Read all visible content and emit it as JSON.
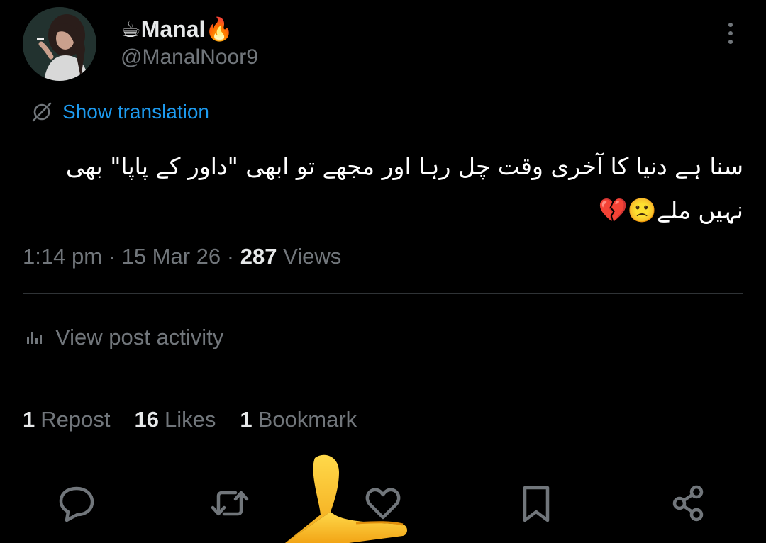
{
  "author": {
    "name": "Manal",
    "name_prefix_emoji": "☕",
    "name_suffix_emoji": "🔥",
    "handle": "@ManalNoor9"
  },
  "translate": {
    "label": "Show translation",
    "icon": "translate-globe-icon"
  },
  "post": {
    "text": "سنا ہے دنیا کا آخری وقت چل رہا اور مجھے تو ابھی \"داور کے پاپا\" بھی نہیں ملے🙁💔"
  },
  "meta": {
    "time": "1:14 pm",
    "separator": " · ",
    "date": "15 Mar 26",
    "views_count": "287",
    "views_label": "Views"
  },
  "activity": {
    "label": "View post activity",
    "icon": "bar-chart-icon"
  },
  "stats": [
    {
      "count": "1",
      "label": "Repost"
    },
    {
      "count": "16",
      "label": "Likes"
    },
    {
      "count": "1",
      "label": "Bookmark"
    }
  ],
  "actions": {
    "reply": "reply-icon",
    "repost": "repost-icon",
    "like": "heart-icon",
    "bookmark": "bookmark-icon",
    "share": "share-icon"
  },
  "colors": {
    "background": "#000000",
    "primary_text": "#e7e9ea",
    "secondary_text": "#71767b",
    "link": "#1d9bf0",
    "divider": "#2f3336"
  }
}
